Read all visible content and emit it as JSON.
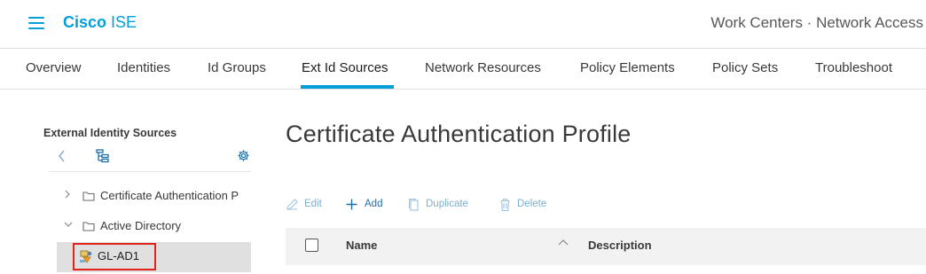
{
  "header": {
    "brand_bold": "Cisco",
    "brand_rest": " ISE",
    "context": "Work Centers · Network Access"
  },
  "tabs": [
    {
      "label": "Overview"
    },
    {
      "label": "Identities"
    },
    {
      "label": "Id Groups"
    },
    {
      "label": "Ext Id Sources",
      "active": true
    },
    {
      "label": "Network Resources"
    },
    {
      "label": "Policy Elements"
    },
    {
      "label": "Policy Sets"
    },
    {
      "label": "Troubleshoot"
    }
  ],
  "sidebar": {
    "title": "External Identity Sources",
    "tree": [
      {
        "label": "Certificate Authentication P",
        "expanded": false
      },
      {
        "label": "Active Directory",
        "expanded": true
      },
      {
        "label": "GL-AD1",
        "selected": true
      }
    ]
  },
  "main": {
    "title": "Certificate Authentication Profile",
    "actions": {
      "edit": "Edit",
      "add": "Add",
      "duplicate": "Duplicate",
      "delete": "Delete"
    },
    "table": {
      "columns": [
        "Name",
        "Description"
      ]
    }
  },
  "colors": {
    "accent": "#049fd9",
    "highlight_border": "#e2231a",
    "selected_row": "#e0e0e0",
    "table_header": "#f2f2f2"
  },
  "icons": [
    "menu-icon",
    "chevron-left-icon",
    "tree-view-icon",
    "gear-icon",
    "chevron-right-icon",
    "chevron-down-icon",
    "folder-icon",
    "ad-join-point-icon",
    "pencil-icon",
    "plus-icon",
    "copy-icon",
    "trash-icon",
    "sort-up-icon"
  ]
}
